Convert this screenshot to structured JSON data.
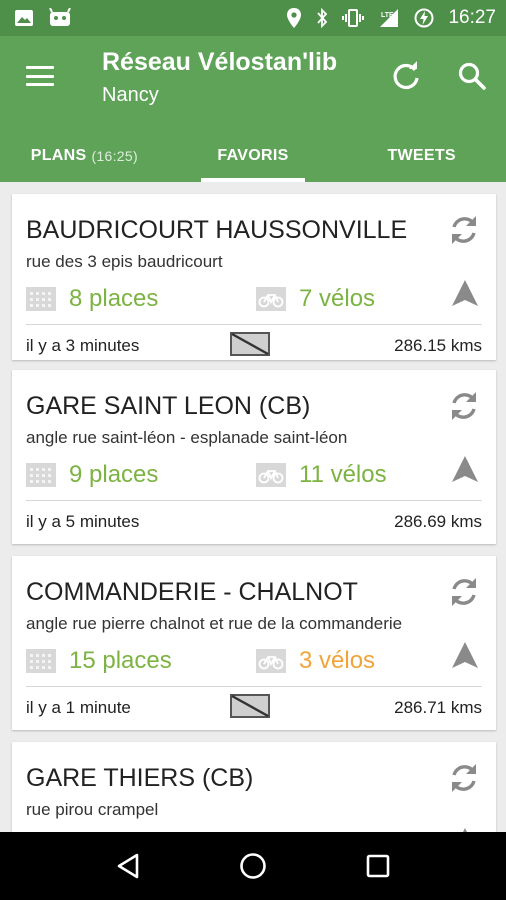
{
  "status_bar": {
    "time": "16:27",
    "left_icons": [
      "image-icon",
      "android-icon"
    ],
    "right_icons": [
      "location-icon",
      "bluetooth-icon",
      "vibrate-icon",
      "lte-signal-icon",
      "battery-charging-icon"
    ]
  },
  "app_bar": {
    "title": "Réseau Vélostan'lib",
    "subtitle": "Nancy",
    "actions": [
      "refresh-icon",
      "search-icon"
    ]
  },
  "tabs": [
    {
      "label": "PLANS",
      "sub": "(16:25)",
      "active": false
    },
    {
      "label": "FAVORIS",
      "sub": "",
      "active": true
    },
    {
      "label": "TWEETS",
      "sub": "",
      "active": false
    }
  ],
  "stations": [
    {
      "name": "BAUDRICOURT HAUSSONVILLE",
      "address": "rue des 3 epis baudricourt",
      "places": "8 places",
      "velos": "7 vélos",
      "velos_color": "#7cb342",
      "updated": "il y a 3 minutes",
      "distance": "286.15 kms",
      "no_gps_icon": true
    },
    {
      "name": "GARE SAINT LEON (CB)",
      "address": "angle rue saint-léon - esplanade saint-léon",
      "places": "9 places",
      "velos": "11 vélos",
      "velos_color": "#7cb342",
      "updated": "il y a 5 minutes",
      "distance": "286.69 kms",
      "no_gps_icon": false
    },
    {
      "name": "COMMANDERIE - CHALNOT",
      "address": "angle rue pierre chalnot et rue de la commanderie",
      "places": "15 places",
      "velos": "3 vélos",
      "velos_color": "#f2a33a",
      "updated": "il y a 1 minute",
      "distance": "286.71 kms",
      "no_gps_icon": true
    },
    {
      "name": "GARE THIERS (CB)",
      "address": "rue pirou crampel",
      "places": "",
      "velos": "",
      "velos_color": "#7cb342",
      "updated": "",
      "distance": "",
      "no_gps_icon": false
    }
  ],
  "colors": {
    "status_bar": "#4e8f4a",
    "app_bar": "#5ea358",
    "places_green": "#7cb342",
    "velos_orange": "#f2a33a"
  },
  "nav_bar": [
    "back-icon",
    "home-icon",
    "recents-icon"
  ]
}
